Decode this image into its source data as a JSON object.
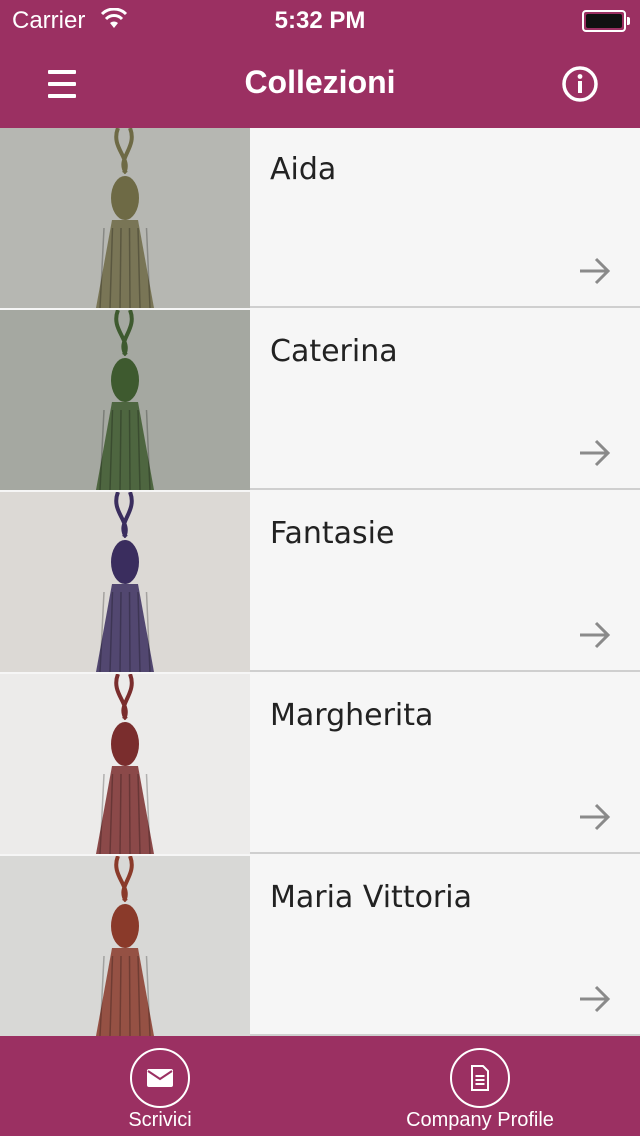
{
  "status": {
    "carrier": "Carrier",
    "time": "5:32 PM"
  },
  "nav": {
    "title": "Collezioni"
  },
  "collections": [
    {
      "name": "Aida",
      "tone": "#b6b7b2",
      "tassel": "#6e6a45"
    },
    {
      "name": "Caterina",
      "tone": "#a5a8a1",
      "tassel": "#3e5a2f"
    },
    {
      "name": "Fantasie",
      "tone": "#dcd9d5",
      "tassel": "#3a2d5e"
    },
    {
      "name": "Margherita",
      "tone": "#ecebea",
      "tassel": "#7a2d2d"
    },
    {
      "name": "Maria Vittoria",
      "tone": "#d8d8d6",
      "tassel": "#8a3a2a"
    }
  ],
  "tabs": {
    "write": "Scrivici",
    "profile": "Company Profile"
  },
  "colors": {
    "brand": "#9b3062",
    "list_bg": "#f6f6f6",
    "divider": "#cfcfcf",
    "arrow": "#8a8a8a"
  }
}
